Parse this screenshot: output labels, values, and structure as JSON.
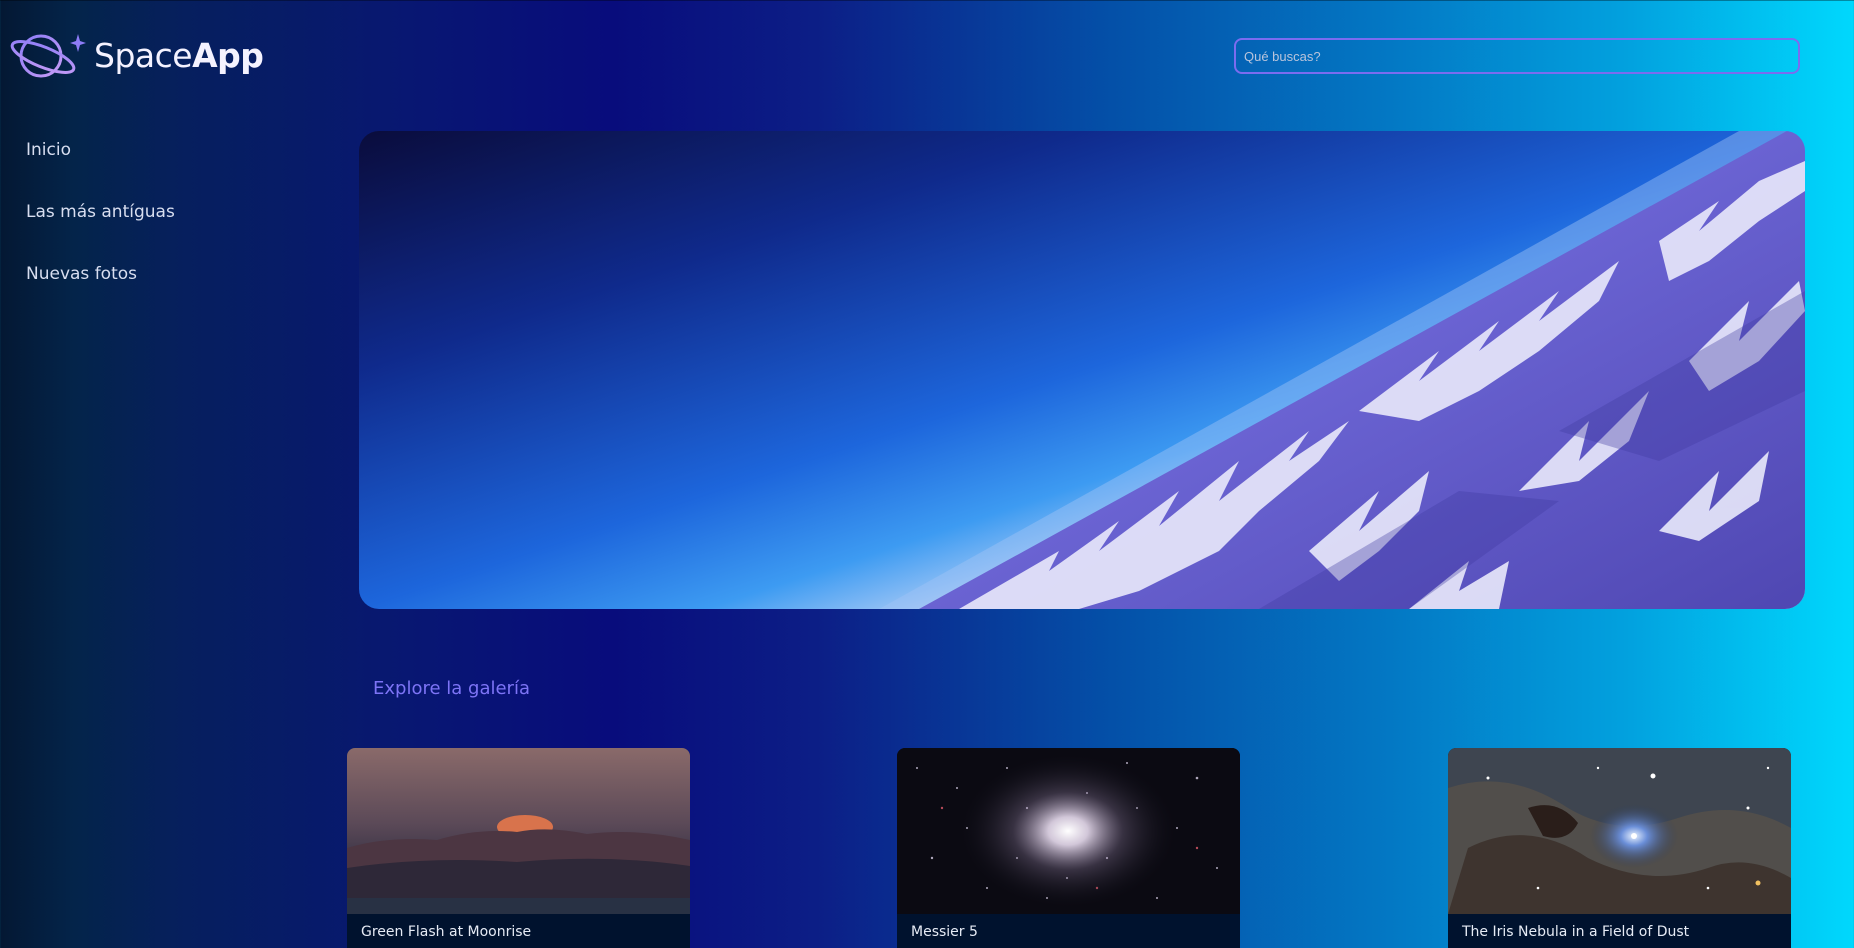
{
  "app": {
    "brand": {
      "name_part1": "Space",
      "name_part2": "App",
      "icon": "planet-sparkle-logo"
    }
  },
  "search": {
    "placeholder": "Qué buscas?",
    "value": ""
  },
  "sidebar": {
    "items": [
      {
        "label": "Inicio"
      },
      {
        "label": "Las más antíguas"
      },
      {
        "label": "Nuevas fotos"
      }
    ]
  },
  "banner": {
    "image": "earth-horizon-mountains-from-space"
  },
  "gallery": {
    "title": "Explore la galería",
    "cards": [
      {
        "title": "Green Flash at Moonrise",
        "image": "moonrise-over-mountains"
      },
      {
        "title": "Messier 5",
        "image": "globular-star-cluster"
      },
      {
        "title": "The Iris Nebula in a Field of Dust",
        "image": "iris-nebula-dust-field"
      }
    ]
  },
  "colors": {
    "accent": "#7b6cf0",
    "gallery_title": "#7d74f6",
    "gradient_left": "#041833",
    "gradient_mid": "#080c7c",
    "gradient_right": "#00d8fd"
  }
}
